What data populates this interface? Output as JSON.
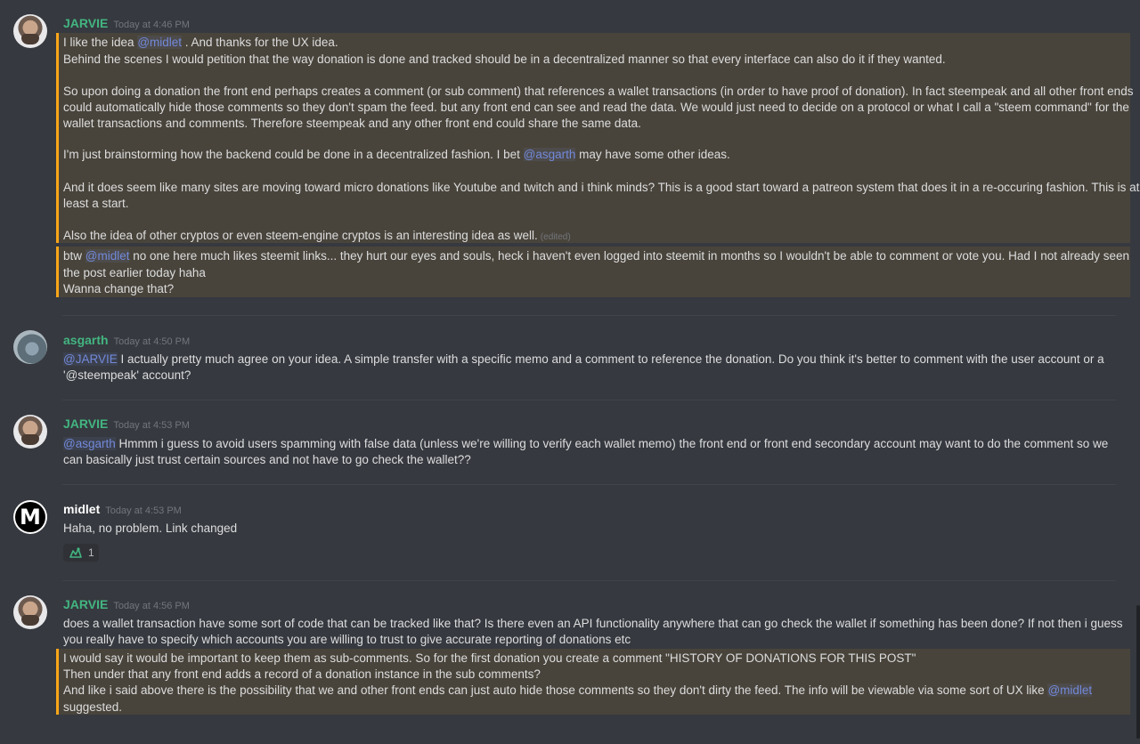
{
  "mentions": {
    "midlet": "@midlet",
    "asgarth": "@asgarth",
    "jarvie": "@JARVIE"
  },
  "msg1": {
    "username": "JARVIE",
    "timestamp": "Today at 4:46 PM",
    "l1a": "I like the idea ",
    "l1b": "  . And thanks for the UX idea.",
    "l2": "Behind the scenes I would petition that the way donation is done and tracked should be in a decentralized manner so that every interface can also do it if they wanted.",
    "l3": "So upon doing a donation the front end perhaps creates a comment (or sub comment) that references a wallet transactions (in order to have proof of donation). In fact steempeak and all other front ends",
    "l4": "could automatically hide those comments so they don't spam the feed. but any front end can see and read the data.  We would just need to decide on a protocol or what I call a \"steem command\" for the",
    "l5": "wallet transactions and comments. Therefore steempeak and any other front end could share the same data.",
    "l6a": "I'm just brainstorming how the backend could be done in a decentralized fashion.  I bet ",
    "l6b": " may have some other ideas.",
    "l7": "And it does seem like many sites are moving toward micro donations like Youtube and twitch  and i think minds? This is a good start toward a patreon system that does it in a re-occuring fashion. This is at",
    "l8": "least a start.",
    "l9": "Also the idea of other cryptos or even steem-engine cryptos is an interesting idea as well.",
    "edited": "(edited)",
    "l10a": "btw ",
    "l10b": " no one here much likes steemit links... they hurt our eyes and souls, heck i haven't even logged into steemit in months so I wouldn't be able to comment or vote you. Had I not already seen",
    "l11": "the post earlier today haha",
    "l12": "Wanna change that?"
  },
  "msg2": {
    "username": "asgarth",
    "timestamp": "Today at 4:50 PM",
    "l1b": " I actually pretty much agree on your idea. A simple transfer with a specific memo and a comment to reference the donation. Do you think it's better to comment with the user account or a",
    "l2": "'@steempeak' account?"
  },
  "msg3": {
    "username": "JARVIE",
    "timestamp": "Today at 4:53 PM",
    "l1b": "  Hmmm i guess to avoid users spamming with false data (unless we're willing to verify each wallet memo) the front end or front end secondary account may want to do the comment so we",
    "l2": "can basically just trust certain sources and not have to go check the wallet??"
  },
  "msg4": {
    "username": "midlet",
    "timestamp": "Today at 4:53 PM",
    "avatar_letter": "M",
    "l1": "Haha, no problem. Link changed",
    "reaction_count": "1",
    "reaction_icon": "thumbs-hand-icon"
  },
  "msg5": {
    "username": "JARVIE",
    "timestamp": "Today at 4:56 PM",
    "l1": "does a wallet transaction have some sort of code that can be tracked like that? Is there even an API functionality anywhere that can go check the wallet if something has been done? If not then i guess",
    "l2": "you really have to specify which accounts you are willing to trust to give accurate reporting of donations etc",
    "l3": "I would say it would be important to keep them as sub-comments. So for the first donation you create a comment \"HISTORY OF DONATIONS FOR THIS POST\"",
    "l4": "Then under that any front end adds a record of a donation instance in the sub comments?",
    "l5a": "And like i said above there is the possibility that we and other front ends can just auto hide those comments so they don't dirty the feed. The info will be viewable via some sort of UX like ",
    "l6": "suggested."
  },
  "colors": {
    "background": "#36393f",
    "highlight_border": "#faa61a",
    "mention": "#7289da",
    "username_green": "#43b581"
  }
}
